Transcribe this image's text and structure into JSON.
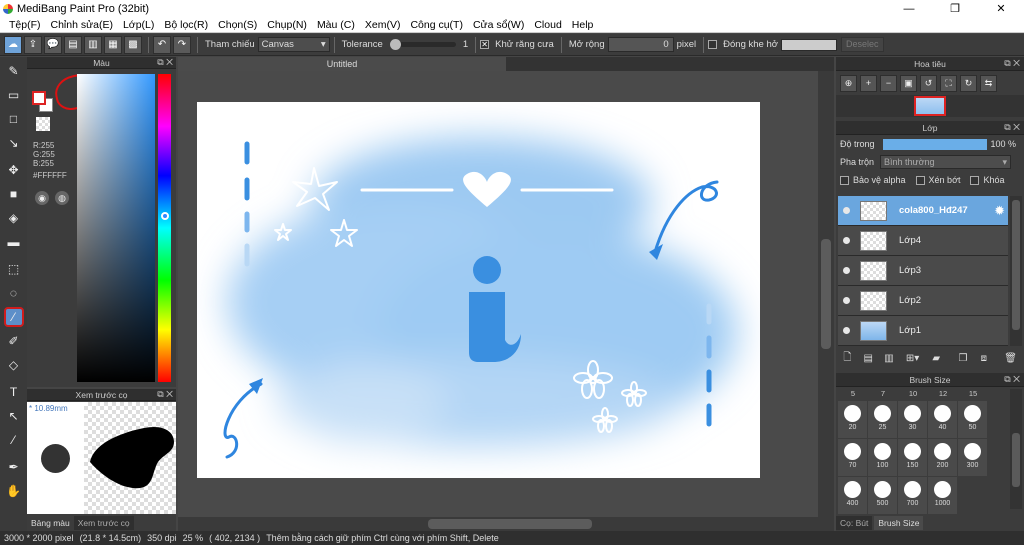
{
  "window": {
    "title": "MediBang Paint Pro (32bit)",
    "controls": {
      "minimize": "—",
      "maximize": "❐",
      "close": "✕"
    }
  },
  "menu": [
    "Tệp(F)",
    "Chỉnh sửa(E)",
    "Lớp(L)",
    "Bộ lọc(R)",
    "Chọn(S)",
    "Chụp(N)",
    "Màu (C)",
    "Xem(V)",
    "Công cụ(T)",
    "Cửa sổ(W)",
    "Cloud",
    "Help"
  ],
  "toolbar": {
    "reference_label": "Tham chiếu",
    "reference_value": "Canvas",
    "tolerance_label": "Tolerance",
    "tolerance_value": "1",
    "antialias_label": "Khử răng cưa",
    "antialias_checked": true,
    "expand_label": "Mở rộng",
    "expand_value": "0",
    "expand_unit": "pixel",
    "close_gap_label": "Đóng khe hở",
    "close_gap_checked": false,
    "deselect_label": "Deselec"
  },
  "color_panel": {
    "title": "Màu",
    "rgb_r": "R:255",
    "rgb_g": "G:255",
    "rgb_b": "B:255",
    "hex": "#FFFFFF",
    "hue_color": "#3388ff"
  },
  "brush_preview": {
    "title": "Xem trước cọ",
    "size": "* 10.89mm",
    "tabs": [
      "Bảng màu",
      "Xem trước cọ"
    ]
  },
  "document": {
    "tab": "Untitled"
  },
  "navigator": {
    "title": "Hoa tiêu"
  },
  "layers": {
    "title": "Lớp",
    "opacity_label": "Độ trong",
    "opacity_value": "100 %",
    "opacity": 1.0,
    "blend_label": "Pha trộn",
    "blend_value": "Bình thường",
    "protect_alpha": "Bảo vệ alpha",
    "clipping": "Xén bớt",
    "lock": "Khóa",
    "items": [
      {
        "name": "cola800_Hđ247",
        "selected": true
      },
      {
        "name": "Lớp4",
        "selected": false
      },
      {
        "name": "Lớp3",
        "selected": false
      },
      {
        "name": "Lớp2",
        "selected": false
      },
      {
        "name": "Lớp1",
        "selected": false
      }
    ]
  },
  "brush_size": {
    "title": "Brush Size",
    "header": [
      "5",
      "7",
      "10",
      "12",
      "15"
    ],
    "rows": [
      [
        "20",
        "25",
        "30",
        "40",
        "50"
      ],
      [
        "70",
        "100",
        "150",
        "200",
        "300"
      ],
      [
        "400",
        "500",
        "700",
        "1000"
      ]
    ],
    "tabs": [
      "Cọ: Bút",
      "Brush Size"
    ]
  },
  "status": {
    "size": "3000 * 2000 pixel",
    "physical": "(21.8 * 14.5cm)",
    "dpi": "350 dpi",
    "zoom": "25 %",
    "coords": "( 402, 2134 )",
    "hint": "Thêm bằng cách giữ phím Ctrl cùng với phím Shift, Delete"
  },
  "colors": {
    "accent": "#6aa6de",
    "canvas_blue": "#8ec2f0",
    "ink_blue": "#2f86df",
    "annotation_red": "#d01c1c"
  }
}
